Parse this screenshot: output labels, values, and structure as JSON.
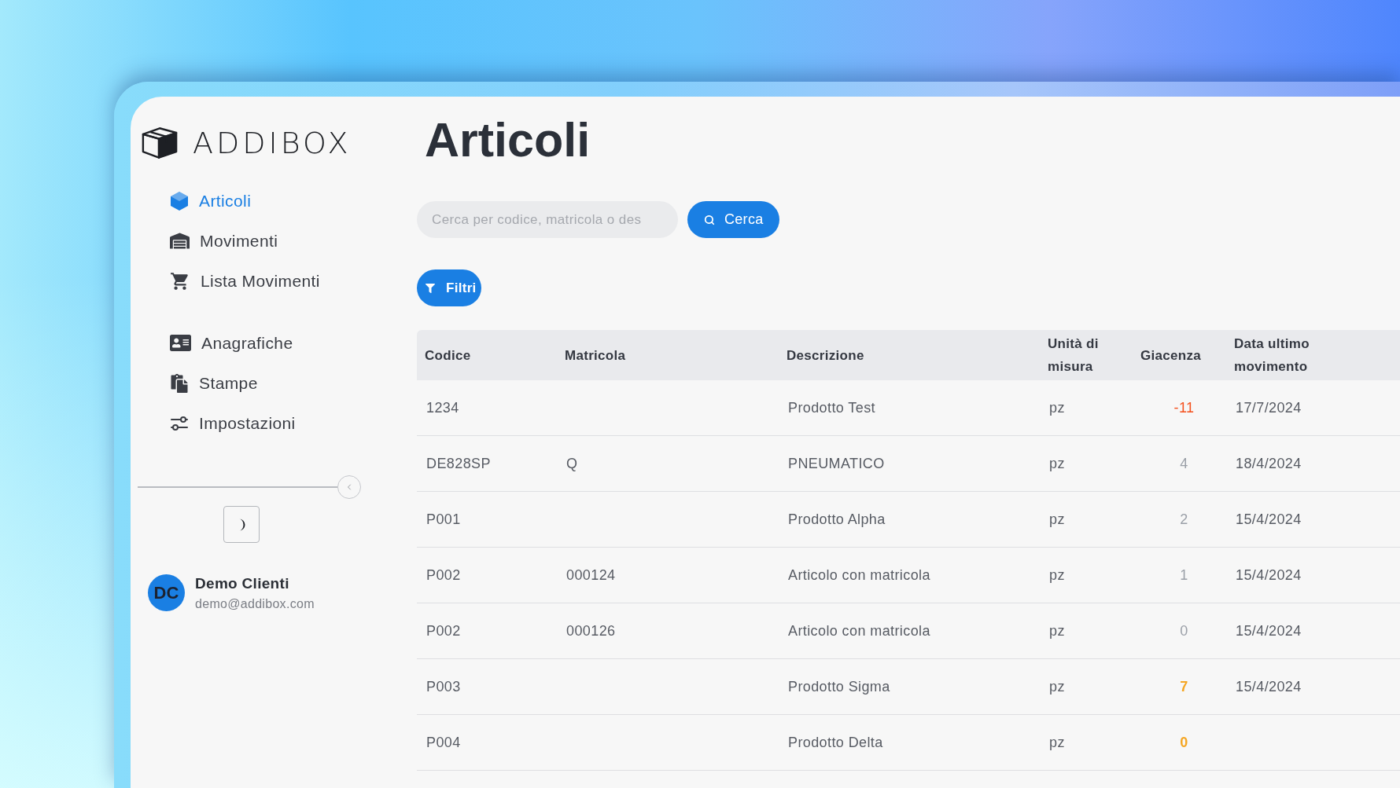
{
  "brand": {
    "name": "ADDIBOX"
  },
  "sidebar": {
    "sections": [
      {
        "items": [
          {
            "label": "Articoli",
            "selected": true
          },
          {
            "label": "Movimenti",
            "selected": false
          },
          {
            "label": "Lista Movimenti",
            "selected": false
          }
        ]
      },
      {
        "items": [
          {
            "label": "Anagrafiche",
            "selected": false
          },
          {
            "label": "Stampe",
            "selected": false
          },
          {
            "label": "Impostazioni",
            "selected": false
          }
        ]
      }
    ],
    "user": {
      "initials": "DC",
      "name": "Demo Clienti",
      "email": "demo@addibox.com"
    }
  },
  "page": {
    "title": "Articoli"
  },
  "search": {
    "placeholder": "Cerca per codice, matricola o des",
    "button": "Cerca"
  },
  "filters": {
    "button": "Filtri"
  },
  "table": {
    "columns": [
      {
        "label": "Codice"
      },
      {
        "label": "Matricola"
      },
      {
        "label": "Descrizione"
      },
      {
        "label": "Unità di misura"
      },
      {
        "label": "Giacenza"
      },
      {
        "label": "Data ultimo movimento"
      }
    ],
    "rows": [
      {
        "code": "1234",
        "description": "Prodotto Test",
        "unit": "pz",
        "stock": "-11",
        "last_movement": "17/7/2024",
        "kind": "negative"
      },
      {
        "code": "DE828SP",
        "serial": "Q",
        "description": "PNEUMATICO",
        "unit": "pz",
        "stock": "4",
        "last_movement": "18/4/2024",
        "kind": "normal"
      },
      {
        "code": "P001",
        "description": "Prodotto Alpha",
        "unit": "pz",
        "stock": "2",
        "last_movement": "15/4/2024",
        "kind": "normal"
      },
      {
        "code": "P002",
        "serial": "000124",
        "description": "Articolo con matricola",
        "unit": "pz",
        "stock": "1",
        "last_movement": "15/4/2024",
        "kind": "normal"
      },
      {
        "code": "P002",
        "serial": "000126",
        "description": "Articolo con matricola",
        "unit": "pz",
        "stock": "0",
        "last_movement": "15/4/2024",
        "kind": "normal"
      },
      {
        "code": "P003",
        "description": "Prodotto Sigma",
        "unit": "pz",
        "stock": "7",
        "last_movement": "15/4/2024",
        "kind": "low"
      },
      {
        "code": "P004",
        "description": "Prodotto Delta",
        "unit": "pz",
        "stock": "0",
        "kind": "low"
      }
    ]
  }
}
